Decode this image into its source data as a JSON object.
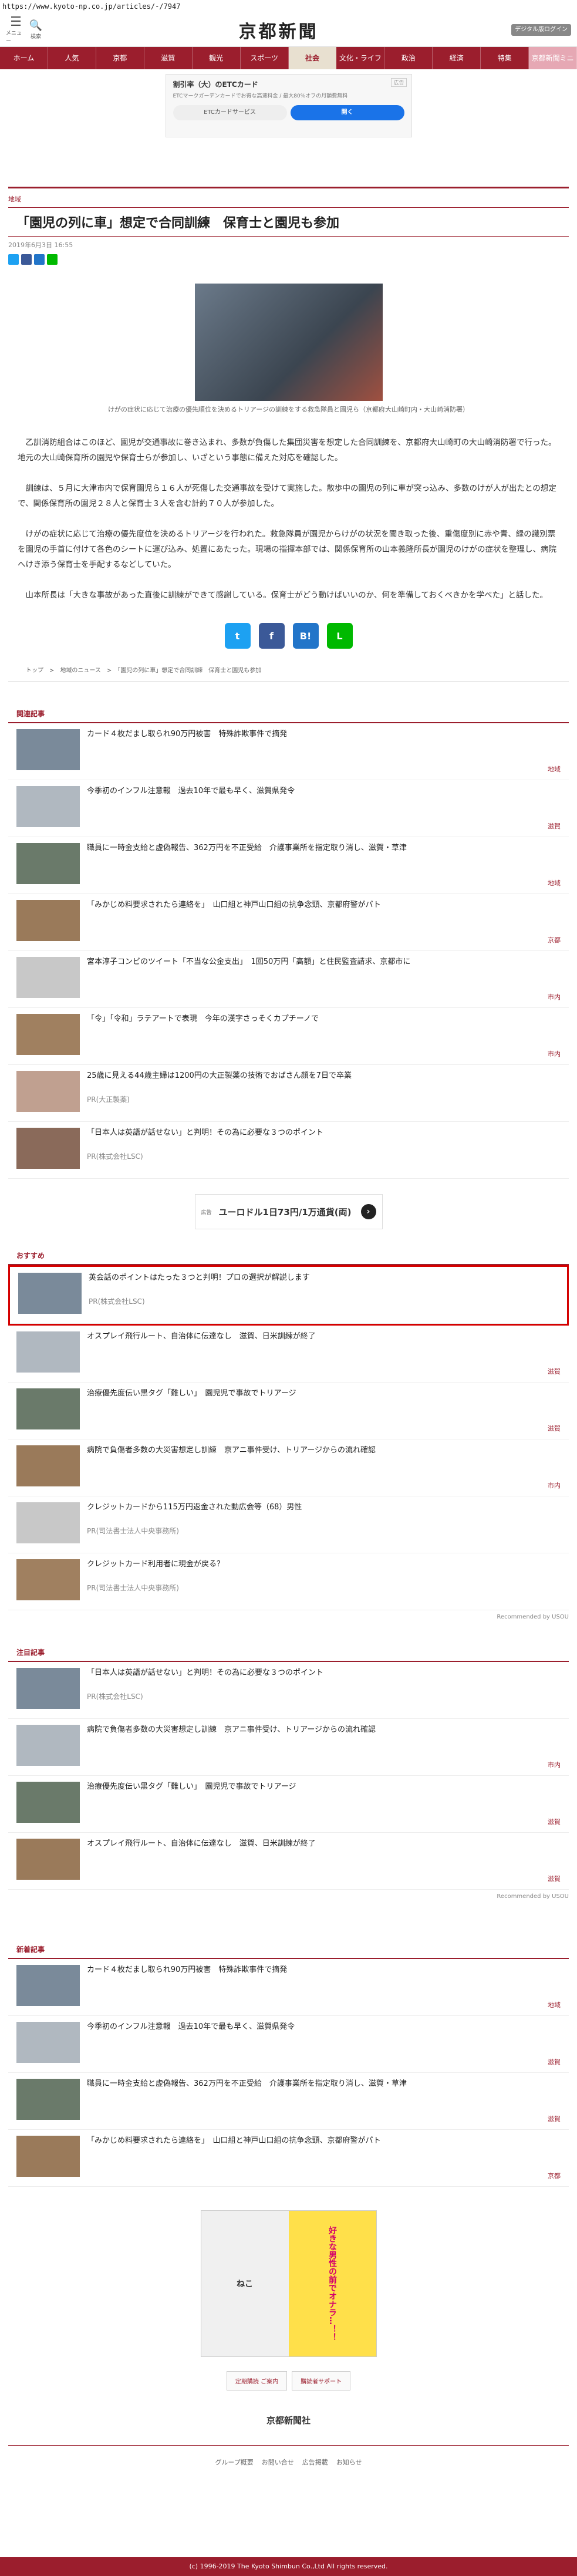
{
  "browser": {
    "url": "https://www.kyoto-np.co.jp/articles/-/7947"
  },
  "header": {
    "logo": "京都新聞",
    "menu_label": "メニュー",
    "search_label": "検索",
    "digital_label": "デジタル版ログイン"
  },
  "nav": [
    "ホーム",
    "人気",
    "京都",
    "滋賀",
    "観光",
    "スポーツ",
    "社会",
    "文化・ライフ",
    "政治",
    "経済",
    "特集",
    "京都新聞ミニ"
  ],
  "ad_top": {
    "title": "割引率（大）のETCカード",
    "badge": "広告",
    "sub": "ETCマークガーデンカードでお得な高速料金 / 最大80%オフの月額費無料",
    "btn_left": "ETCカードサービス",
    "btn_right": "開く"
  },
  "article": {
    "category": "地域",
    "title": "「園児の列に車」想定で合同訓練　保育士と園児も参加",
    "date": "2019年6月3日 16:55",
    "caption": "けがの症状に応じて治療の優先順位を決めるトリアージの訓練をする救急隊員と園児ら（京都府大山崎町内・大山崎消防署）",
    "paragraphs": [
      "乙訓消防組合はこのほど、園児が交通事故に巻き込まれ、多数が負傷した集団災害を想定した合同訓練を、京都府大山崎町の大山崎消防署で行った。地元の大山崎保育所の園児や保育士らが参加し、いざという事態に備えた対応を確認した。",
      "訓練は、５月に大津市内で保育園児ら１６人が死傷した交通事故を受けて実施した。散歩中の園児の列に車が突っ込み、多数のけが人が出たとの想定で、関係保育所の園児２８人と保育士３人を含む計約７０人が参加した。",
      "けがの症状に応じて治療の優先度位を決めるトリアージを行われた。救急隊員が園児からけがの状況を聞き取った後、重傷度別に赤や青、緑の識別票を園児の手首に付けて各色のシートに運び込み、処置にあたった。現場の指揮本部では、関係保育所の山本義隆所長が園児のけがの症状を整理し、病院へけき添う保育士を手配するなどしていた。",
      "山本所長は「大きな事故があった直後に訓練ができて感謝している。保育士がどう動けばいいのか、何を準備しておくべきかを学べた」と話した。"
    ],
    "breadcrumbs": "トップ　>　地域のニュース　>　「園児の列に車」想定で合同訓練　保育士と園児も参加"
  },
  "related": {
    "heading": "関連記事",
    "items": [
      {
        "title": "カード４枚だまし取られ90万円被害　特殊詐欺事件で摘発",
        "tag": "地域",
        "pr": ""
      },
      {
        "title": "今季初のインフル注意報　過去10年で最も早く、滋賀県発令",
        "tag": "滋賀",
        "pr": ""
      },
      {
        "title": "職員に一時金支給と虚偽報告、362万円を不正受給　介護事業所を指定取り消し、滋賀・草津",
        "tag": "地域",
        "pr": ""
      },
      {
        "title": "「みかじめ料要求されたら連絡を」　山口組と神戸山口組の抗争念頭、京都府警がパト",
        "tag": "京都",
        "pr": ""
      },
      {
        "title": "宮本淳子コンビのツイート「不当な公金支出」　1回50万円「高額」と住民監査請求、京都市に",
        "tag": "市内",
        "pr": ""
      },
      {
        "title": "「令」「令和」ラテアートで表現　今年の漢字さっそくカプチーノで",
        "tag": "市内",
        "pr": ""
      },
      {
        "title": "25歳に見える44歳主婦は1200円の大正製薬の技術でおばさん顔を7日で卒業",
        "tag": "",
        "pr": "PR(大正製薬)"
      },
      {
        "title": "「日本人は英語が話せない」と判明！その為に必要な３つのポイント",
        "tag": "",
        "pr": "PR(株式会社LSC)"
      }
    ]
  },
  "ad_mid": {
    "text": "ユーロドル1日73円/1万通貨(両)",
    "badge": "広告"
  },
  "recommend": {
    "heading": "おすすめ",
    "items": [
      {
        "title": "英会話のポイントはたった３つと判明！プロの選択が解説します",
        "tag": "",
        "pr": "PR(株式会社LSC)"
      },
      {
        "title": "オスプレイ飛行ルート、自治体に伝達なし　滋賀、日米訓練が終了",
        "tag": "滋賀",
        "pr": ""
      },
      {
        "title": "治療優先度伝い黒タグ「難しい」　園児児で事故でトリアージ",
        "tag": "滋賀",
        "pr": ""
      },
      {
        "title": "病院で負傷者多数の大災害想定し訓練　京アニ事件受け、トリアージからの流れ確認",
        "tag": "市内",
        "pr": ""
      },
      {
        "title": "クレジットカードから115万円返金された動広会等（68）男性",
        "tag": "",
        "pr": "PR(司法書士法人中央事務所)"
      },
      {
        "title": "クレジットカード利用者に現金が戻る？",
        "tag": "",
        "pr": "PR(司法書士法人中央事務所)"
      }
    ],
    "recommended_by": "Recommended by USOU"
  },
  "attention": {
    "heading": "注目記事",
    "items": [
      {
        "title": "「日本人は英語が話せない」と判明！その為に必要な３つのポイント",
        "tag": "",
        "pr": "PR(株式会社LSC)"
      },
      {
        "title": "病院で負傷者多数の大災害想定し訓練　京アニ事件受け、トリアージからの流れ確認",
        "tag": "市内",
        "pr": ""
      },
      {
        "title": "治療優先度伝い黒タグ「難しい」　園児児で事故でトリアージ",
        "tag": "滋賀",
        "pr": ""
      },
      {
        "title": "オスプレイ飛行ルート、自治体に伝達なし　滋賀、日米訓練が終了",
        "tag": "滋賀",
        "pr": ""
      }
    ],
    "recommended_by": "Recommended by USOU"
  },
  "latest": {
    "heading": "新着記事",
    "items": [
      {
        "title": "カード４枚だまし取られ90万円被害　特殊詐欺事件で摘発",
        "tag": "地域",
        "pr": ""
      },
      {
        "title": "今季初のインフル注意報　過去10年で最も早く、滋賀県発令",
        "tag": "滋賀",
        "pr": ""
      },
      {
        "title": "職員に一時金支給と虚偽報告、362万円を不正受給　介護事業所を指定取り消し、滋賀・草津",
        "tag": "滋賀",
        "pr": ""
      },
      {
        "title": "「みかじめ料要求されたら連絡を」　山口組と神戸山口組の抗争念頭、京都府警がパト",
        "tag": "京都",
        "pr": ""
      }
    ]
  },
  "bottom_ad": {
    "left": "ねこ",
    "right": "好きな男性の前でオナラ…！！"
  },
  "footer": {
    "btn_subscribe": "定期購読 ご案内",
    "btn_support": "購読者サポート",
    "logo": "京都新聞社",
    "links": [
      "グループ概要",
      "お問い合せ",
      "広告掲載",
      "お知らせ"
    ],
    "copyright": "(c) 1996-2019 The Kyoto Shimbun Co.,Ltd All rights reserved."
  }
}
